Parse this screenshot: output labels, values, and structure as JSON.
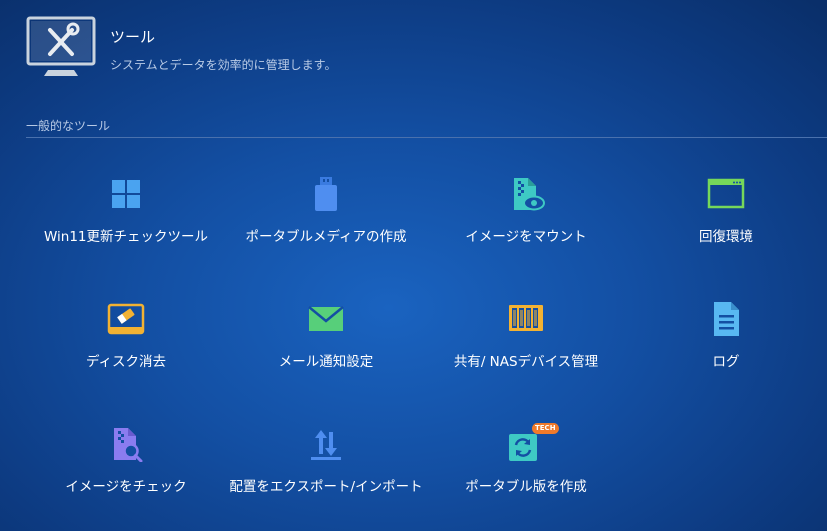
{
  "header": {
    "title": "ツール",
    "subtitle": "システムとデータを効率的に管理します。",
    "icon": "tools-monitor-icon"
  },
  "section": {
    "title": "一般的なツール"
  },
  "tools": [
    {
      "label": "Win11更新チェックツール",
      "icon": "windows-logo-icon"
    },
    {
      "label": "ポータブルメディアの作成",
      "icon": "usb-drive-icon"
    },
    {
      "label": "イメージをマウント",
      "icon": "mount-image-icon"
    },
    {
      "label": "回復環境",
      "icon": "window-frame-icon"
    },
    {
      "label": "ディスク消去",
      "icon": "disk-eraser-icon"
    },
    {
      "label": "メール通知設定",
      "icon": "envelope-icon"
    },
    {
      "label": "共有/ NASデバイス管理",
      "icon": "nas-device-icon"
    },
    {
      "label": "ログ",
      "icon": "log-document-icon"
    },
    {
      "label": "イメージをチェック",
      "icon": "check-image-icon"
    },
    {
      "label": "配置をエクスポート/インポート",
      "icon": "export-import-icon"
    },
    {
      "label": "ポータブル版を作成",
      "icon": "portable-version-icon",
      "badge": "TECH"
    }
  ],
  "colors": {
    "background": "#134fa3",
    "windows_blue": "#4aa3f0",
    "usb_blue": "#4f8ef0",
    "teal": "#3ec9c4",
    "green": "#76d85a",
    "orange": "#f2b233",
    "envelope_green": "#57cf7a",
    "doc_blue": "#58b8f2",
    "purple": "#8a7cf0",
    "badge_orange": "#f07a2a"
  }
}
